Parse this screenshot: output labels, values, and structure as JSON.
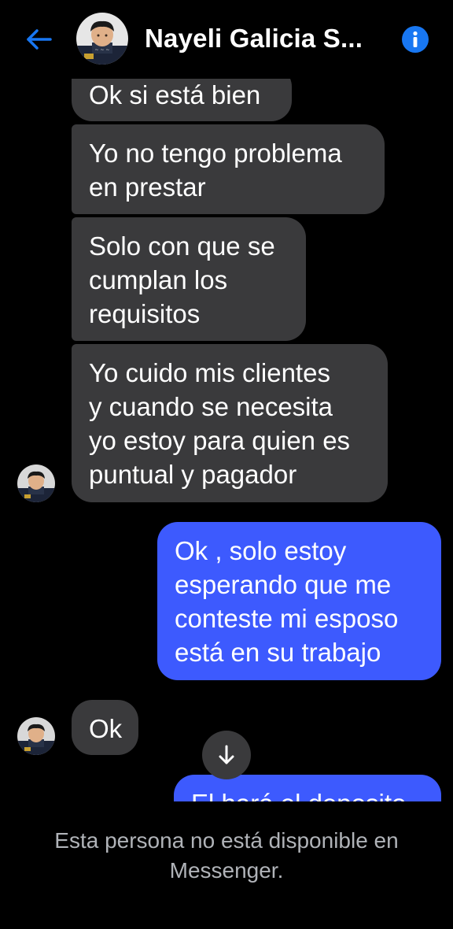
{
  "header": {
    "contact_name": "Nayeli Galicia S...",
    "back_icon": "arrow-left-icon",
    "info_icon": "info-icon",
    "accent_color": "#1877f2"
  },
  "messages": [
    {
      "from": "contact",
      "text": "Ok si está bien"
    },
    {
      "from": "contact",
      "text": "Yo no tengo problema\nen prestar"
    },
    {
      "from": "contact",
      "text": "Solo con que se\ncumplan los\nrequisitos"
    },
    {
      "from": "contact",
      "text": "Yo cuido mis clientes\ny cuando se necesita\nyo estoy para quien es\npuntual y pagador"
    },
    {
      "from": "me",
      "text": "Ok , solo estoy\nesperando que me\nconteste mi esposo\nestá en su trabajo"
    },
    {
      "from": "contact",
      "text": "Ok"
    },
    {
      "from": "me",
      "text": "El hará el deposito"
    }
  ],
  "colors": {
    "incoming_bubble": "#3a3a3c",
    "outgoing_bubble": "#3d5afe",
    "background": "#000000"
  },
  "scroll_button_icon": "arrow-down-icon",
  "footer": {
    "notice": "Esta persona no está disponible en\nMessenger."
  }
}
